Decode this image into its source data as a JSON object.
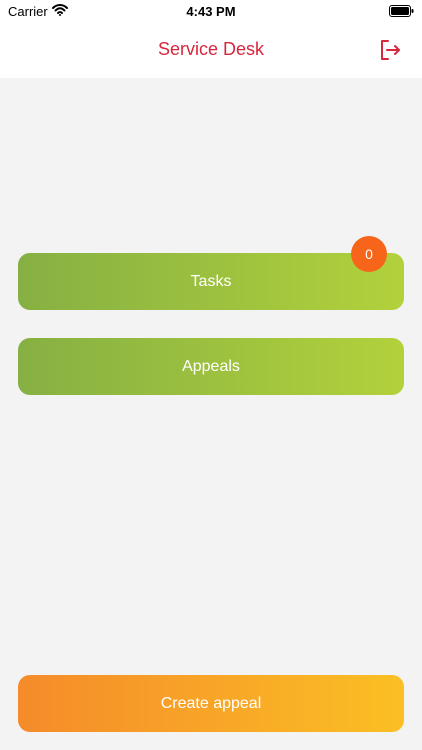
{
  "status_bar": {
    "carrier": "Carrier",
    "time": "4:43 PM"
  },
  "header": {
    "title": "Service Desk",
    "title_color": "#d7263d",
    "logout_icon": "logout-icon"
  },
  "menu": {
    "tasks": {
      "label": "Tasks",
      "badge_count": "0"
    },
    "appeals": {
      "label": "Appeals"
    }
  },
  "footer": {
    "create_label": "Create appeal"
  },
  "colors": {
    "green_start": "#86b043",
    "green_end": "#b2d13b",
    "orange_start": "#f58b2a",
    "orange_end": "#fbbf24",
    "badge": "#f6651a"
  }
}
